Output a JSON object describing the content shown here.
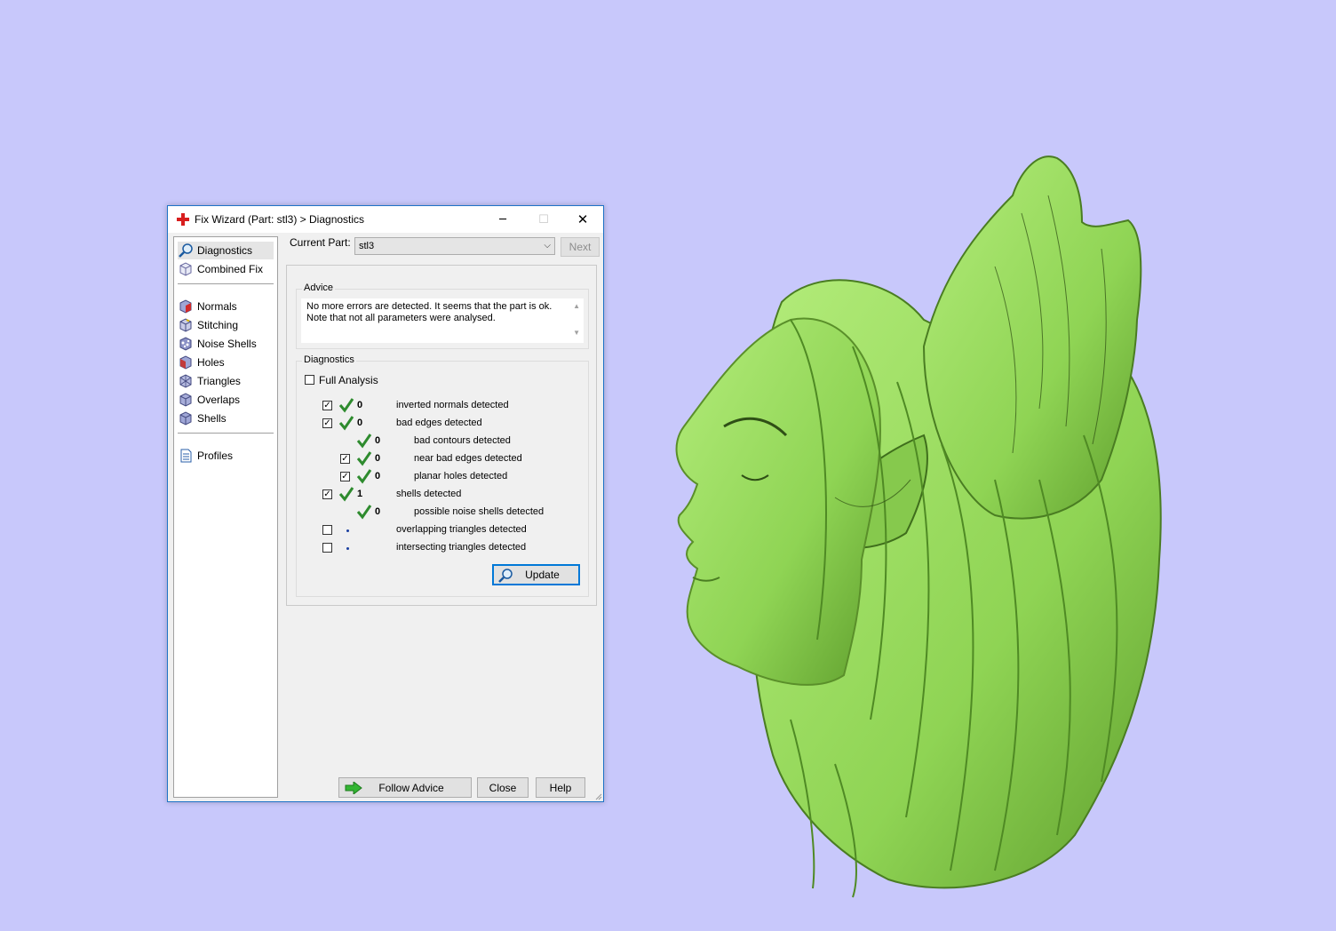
{
  "window": {
    "title": "Fix Wizard (Part: stl3) > Diagnostics",
    "controls": {
      "minimize": "─",
      "maximize": "☐",
      "close": "✕"
    }
  },
  "sidebar": {
    "items": [
      {
        "label": "Diagnostics",
        "icon": "magnifier-icon",
        "selected": true
      },
      {
        "label": "Combined Fix",
        "icon": "cube-icon"
      },
      {
        "label": "Normals",
        "icon": "normals-cube-icon"
      },
      {
        "label": "Stitching",
        "icon": "stitching-cube-icon"
      },
      {
        "label": "Noise Shells",
        "icon": "noise-shells-icon"
      },
      {
        "label": "Holes",
        "icon": "holes-cube-icon"
      },
      {
        "label": "Triangles",
        "icon": "triangles-cube-icon"
      },
      {
        "label": "Overlaps",
        "icon": "overlaps-cube-icon"
      },
      {
        "label": "Shells",
        "icon": "shells-cube-icon"
      },
      {
        "label": "Profiles",
        "icon": "document-icon"
      }
    ]
  },
  "part": {
    "label": "Current Part:",
    "value": "stl3",
    "next_label": "Next"
  },
  "advice": {
    "title": "Advice",
    "line1": "No more errors are detected. It seems that the part is ok.",
    "line2": "Note that not all parameters were analysed."
  },
  "diagnostics": {
    "title": "Diagnostics",
    "full_analysis_label": "Full Analysis",
    "full_analysis_checked": false,
    "rows": [
      {
        "label": "inverted normals detected",
        "count": "0",
        "checked": true,
        "status": "ok"
      },
      {
        "label": "bad edges detected",
        "count": "0",
        "checked": true,
        "status": "ok"
      },
      {
        "label": "bad contours detected",
        "count": "0",
        "status": "ok"
      },
      {
        "label": "near bad edges detected",
        "count": "0",
        "checked": true,
        "status": "ok"
      },
      {
        "label": "planar holes detected",
        "count": "0",
        "checked": true,
        "status": "ok"
      },
      {
        "label": "shells detected",
        "count": "1",
        "checked": true,
        "status": "ok"
      },
      {
        "label": "possible noise shells detected",
        "count": "0",
        "status": "ok"
      },
      {
        "label": "overlapping triangles detected",
        "count": "",
        "checked": false,
        "status": "not-analysed"
      },
      {
        "label": "intersecting triangles detected",
        "count": "",
        "checked": false,
        "status": "not-analysed"
      }
    ],
    "update_label": "Update"
  },
  "footer": {
    "follow_advice_label": "Follow Advice",
    "close_label": "Close",
    "help_label": "Help"
  },
  "colors": {
    "background": "#c8c8fb",
    "model_green": "#8fd454",
    "check_green": "#2e8b2e",
    "window_border": "#1e73c7"
  }
}
